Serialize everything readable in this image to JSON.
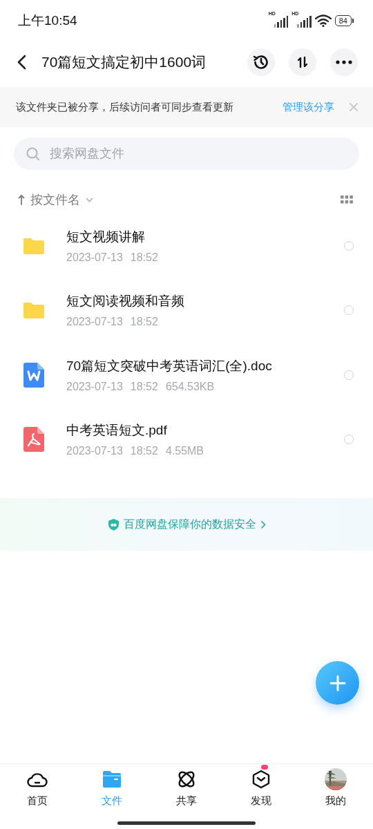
{
  "status_bar": {
    "time": "上午10:54",
    "signal_labels": [
      "HD",
      "HD"
    ],
    "battery": "84"
  },
  "header": {
    "title": "70篇短文搞定初中1600词"
  },
  "share_banner": {
    "text": "该文件夹已被分享，后续访问者可同步查看更新",
    "link": "管理该分享"
  },
  "search": {
    "placeholder": "搜索网盘文件"
  },
  "sort": {
    "label": "按文件名"
  },
  "files": [
    {
      "kind": "folder",
      "name": "短文视频讲解",
      "date": "2023-07-13",
      "time": "18:52",
      "selected": false
    },
    {
      "kind": "folder",
      "name": "短文阅读视频和音频",
      "date": "2023-07-13",
      "time": "18:52",
      "selected": false
    },
    {
      "kind": "doc",
      "name": "70篇短文突破中考英语词汇(全).doc",
      "date": "2023-07-13",
      "time": "18:52",
      "size": "654.53KB",
      "selected": false
    },
    {
      "kind": "pdf",
      "name": "中考英语短文.pdf",
      "date": "2023-07-13",
      "time": "18:52",
      "size": "4.55MB",
      "selected": false
    }
  ],
  "safety_note": "百度网盘保障你的数据安全",
  "nav": [
    {
      "kind": "home",
      "label": "首页",
      "selected": false,
      "badge": false
    },
    {
      "kind": "files",
      "label": "文件",
      "selected": true,
      "badge": false
    },
    {
      "kind": "share",
      "label": "共享",
      "selected": false,
      "badge": false
    },
    {
      "kind": "discover",
      "label": "发现",
      "selected": false,
      "badge": true
    },
    {
      "kind": "me",
      "label": "我的",
      "selected": false,
      "badge": false
    }
  ]
}
